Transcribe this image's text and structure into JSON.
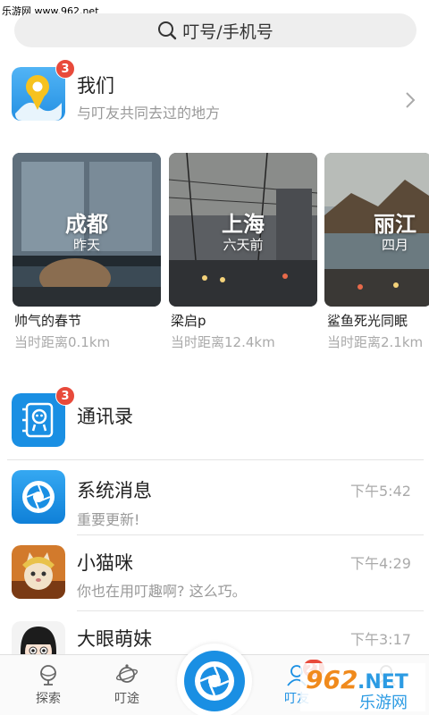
{
  "watermark_top": "乐游网 www.962.net",
  "search": {
    "placeholder_text": "叮号/手机号"
  },
  "us": {
    "title": "我们",
    "subtitle": "与叮友共同去过的地方",
    "badge": "3"
  },
  "cards": [
    {
      "city": "成都",
      "time": "昨天",
      "title": "帅气的春节",
      "distance": "当时距离0.1km"
    },
    {
      "city": "上海",
      "time": "六天前",
      "title": "梁启p",
      "distance": "当时距离12.4km"
    },
    {
      "city": "丽江",
      "time": "四月",
      "title": "鲨鱼死光同眠",
      "distance": "当时距离2.1km"
    }
  ],
  "contacts": {
    "title": "通讯录",
    "badge": "3"
  },
  "messages": [
    {
      "name": "系统消息",
      "preview": "重要更新!",
      "time": "下午5:42"
    },
    {
      "name": "小猫咪",
      "preview": "你也在用叮趣啊? 这么巧。",
      "time": "下午4:29"
    },
    {
      "name": "大眼萌妹",
      "preview": "",
      "time": "下午3:17"
    }
  ],
  "tabs": [
    {
      "label": "探索",
      "icon": "globe-icon"
    },
    {
      "label": "叮途",
      "icon": "planet-icon"
    },
    {
      "label": "叮友",
      "icon": "friends-icon",
      "badge": "21"
    },
    {
      "label": "",
      "icon": "profile-icon"
    }
  ],
  "watermark_bottom": {
    "line1": "962",
    "line2": ".NET",
    "line3": "乐游网"
  },
  "colors": {
    "accent": "#1a8fe3",
    "badge": "#e84a3b",
    "search_bg": "#eeeeee"
  }
}
